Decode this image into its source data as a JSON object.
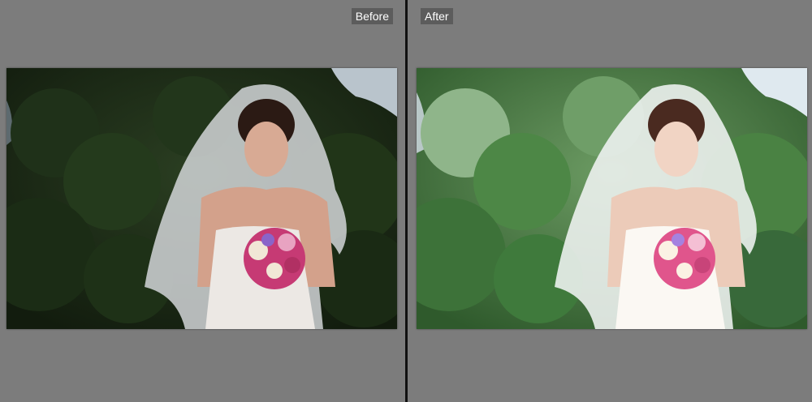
{
  "compare_view": {
    "before": {
      "label": "Before"
    },
    "after": {
      "label": "After"
    }
  },
  "colors": {
    "workspace_background": "#7c7c7c",
    "label_background": "#5c5c5c",
    "label_text": "#ffffff",
    "divider": "#111111",
    "before_foliage": "#1e2f17",
    "after_foliage": "#3f7a3c"
  }
}
